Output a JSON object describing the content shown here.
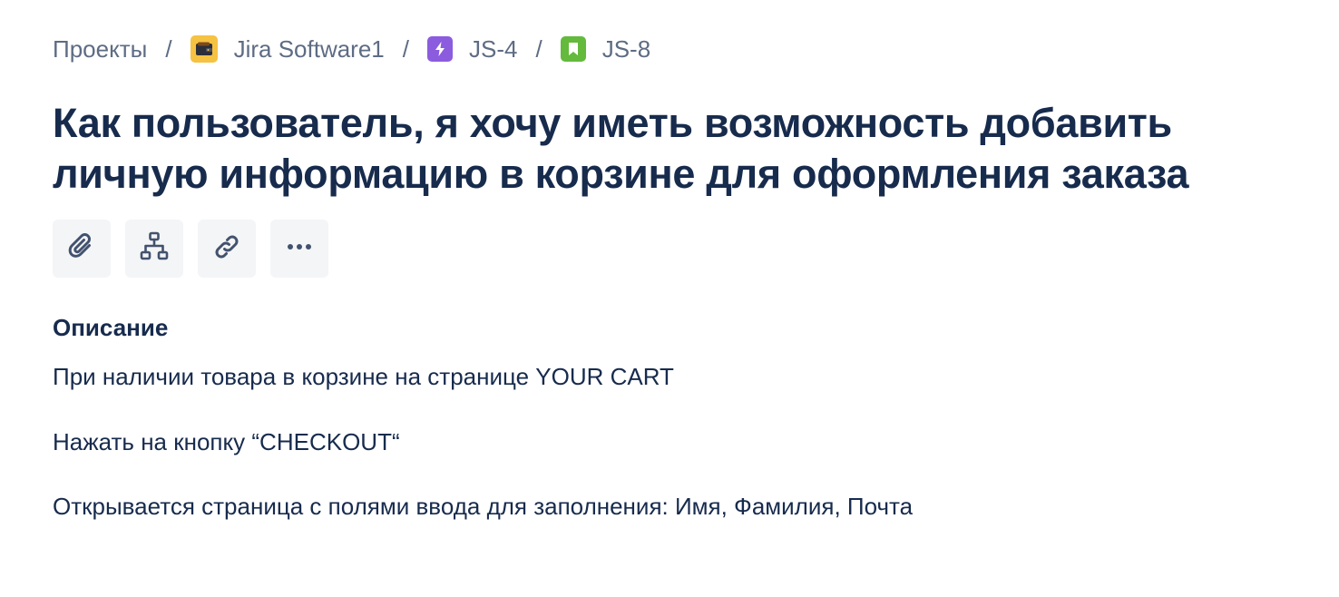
{
  "breadcrumb": {
    "items": [
      {
        "label": "Проекты",
        "icon": null
      },
      {
        "label": "Jira Software1",
        "icon": "project-wallet-icon"
      },
      {
        "label": "JS-4",
        "icon": "epic-lightning-icon"
      },
      {
        "label": "JS-8",
        "icon": "story-bookmark-icon"
      }
    ],
    "separator": "/"
  },
  "issue": {
    "title": "Как пользователь, я хочу иметь возможность добавить личную информацию в корзине для оформления заказа"
  },
  "toolbar": {
    "buttons": [
      {
        "icon": "paperclip-icon"
      },
      {
        "icon": "child-issues-icon"
      },
      {
        "icon": "link-icon"
      },
      {
        "icon": "more-icon"
      }
    ]
  },
  "description": {
    "heading": "Описание",
    "paragraphs": [
      "При наличии товара в корзине на странице YOUR CART",
      "Нажать на кнопку “CHECKOUT“",
      "Открывается страница с полями ввода для заполнения: Имя, Фамилия, Почта"
    ]
  },
  "colors": {
    "text_primary": "#172b4d",
    "text_secondary": "#5e6c84",
    "button_bg": "#f4f5f7",
    "project_icon": "#f5c242",
    "epic_icon": "#8b5cde",
    "story_icon": "#63ba3c"
  }
}
